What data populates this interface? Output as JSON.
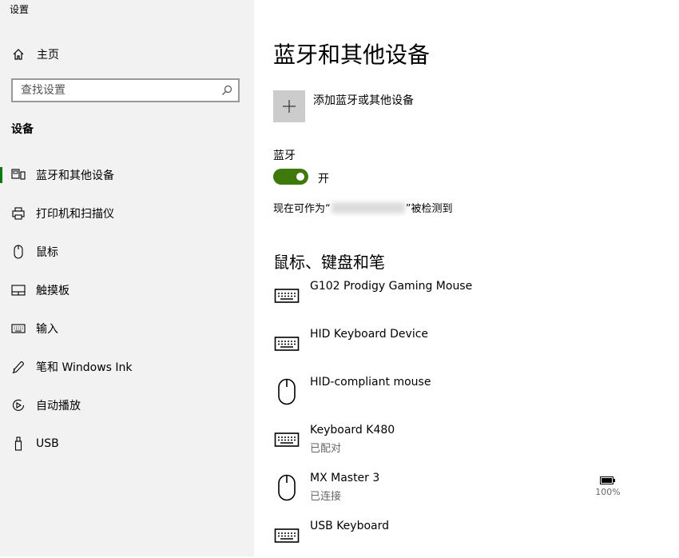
{
  "app": {
    "title": "设置"
  },
  "sidebar": {
    "home_label": "主页",
    "search_placeholder": "查找设置",
    "section_heading": "设备",
    "items": [
      {
        "label": "蓝牙和其他设备",
        "icon": "bluetooth-devices-icon",
        "active": true
      },
      {
        "label": "打印机和扫描仪",
        "icon": "printer-icon"
      },
      {
        "label": "鼠标",
        "icon": "mouse-icon"
      },
      {
        "label": "触摸板",
        "icon": "touchpad-icon"
      },
      {
        "label": "输入",
        "icon": "keyboard-icon"
      },
      {
        "label": "笔和 Windows Ink",
        "icon": "pen-icon"
      },
      {
        "label": "自动播放",
        "icon": "autoplay-icon"
      },
      {
        "label": "USB",
        "icon": "usb-icon"
      }
    ]
  },
  "main": {
    "title": "蓝牙和其他设备",
    "add_device_label": "添加蓝牙或其他设备",
    "bluetooth": {
      "label": "蓝牙",
      "state": "开",
      "discoverable_prefix": "现在可作为“",
      "discoverable_suffix": "”被检测到"
    },
    "section_title": "鼠标、键盘和笔",
    "devices": [
      {
        "name": "G102 Prodigy Gaming Mouse",
        "status": "",
        "icon": "keyboard-icon"
      },
      {
        "name": "HID Keyboard Device",
        "status": "",
        "icon": "keyboard-icon"
      },
      {
        "name": "HID-compliant mouse",
        "status": "",
        "icon": "mouse-icon"
      },
      {
        "name": "Keyboard K480",
        "status": "已配对",
        "icon": "keyboard-icon"
      },
      {
        "name": "MX Master 3",
        "status": "已连接",
        "icon": "mouse-icon",
        "battery": "100%"
      },
      {
        "name": "USB Keyboard",
        "status": "",
        "icon": "keyboard-icon"
      }
    ]
  },
  "colors": {
    "accent": "#3d7a0b",
    "sidebar_bg": "#f2f2f2",
    "active_indicator": "#0b7a0b"
  }
}
